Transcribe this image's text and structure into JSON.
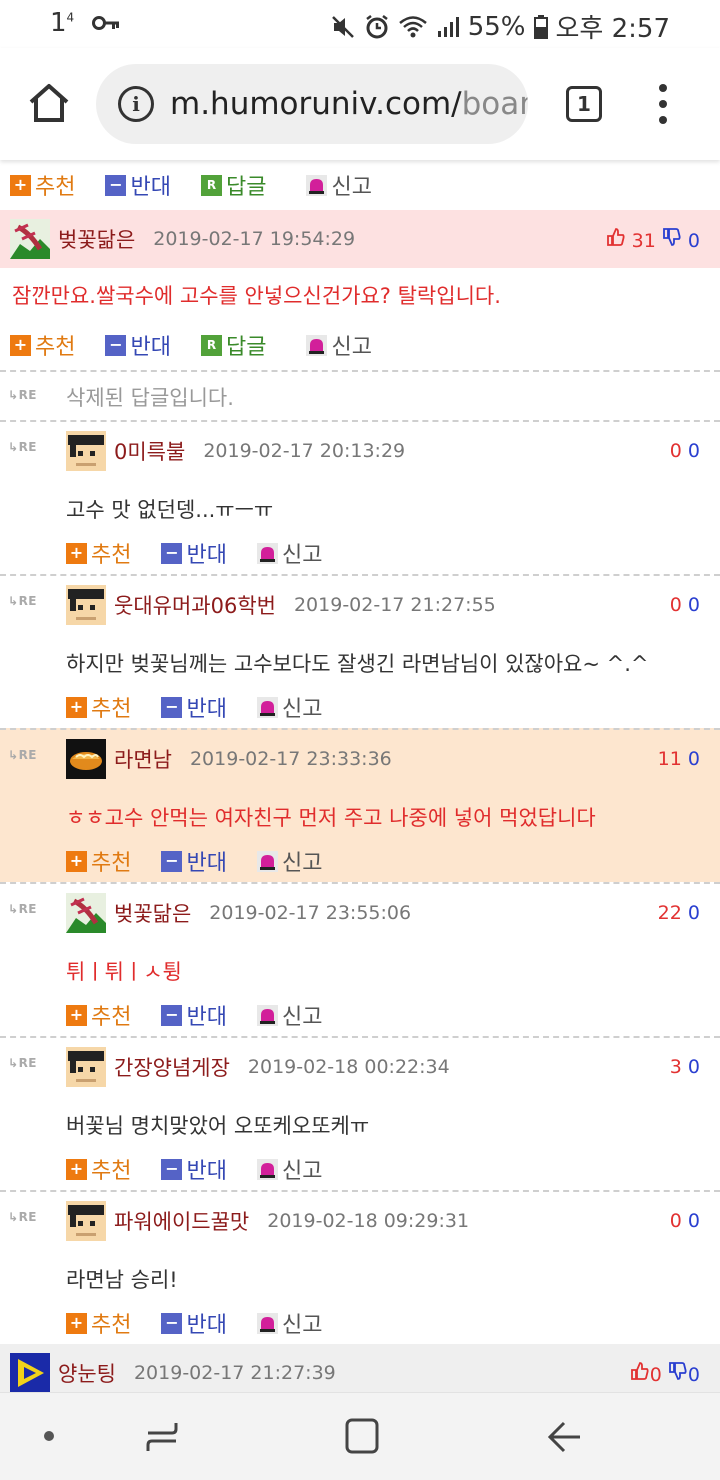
{
  "status_bar": {
    "notif_count": "1",
    "notif_sup": "4",
    "battery": "55%",
    "time": "오후 2:57"
  },
  "browser": {
    "url_main": "m.humoruniv.com/",
    "url_dim": "boar",
    "tab_count": "1"
  },
  "actions": {
    "up": "추천",
    "down": "반대",
    "reply": "답글",
    "report": "신고",
    "reply_icon": "R"
  },
  "deleted_text": "삭제된 답글입니다.",
  "re_label": "RE",
  "comments": {
    "c1": {
      "nick": "벚꽃닮은",
      "date": "2019-02-17 19:54:29",
      "up": "31",
      "down": "0",
      "text": "잠깐만요.쌀국수에 고수를 안넣으신건가요? 탈락입니다."
    },
    "r1": {
      "nick": "0미륵불",
      "date": "2019-02-17 20:13:29",
      "up": "0",
      "down": "0",
      "text": "고수 맛 없던뎅...ㅠㅡㅠ"
    },
    "r2": {
      "nick": "웃대유머과06학번",
      "date": "2019-02-17 21:27:55",
      "up": "0",
      "down": "0",
      "text": "하지만 벚꽃님께는 고수보다도 잘생긴 라면남님이 있잖아요~ ^.^"
    },
    "r3": {
      "nick": "라면남",
      "date": "2019-02-17 23:33:36",
      "up": "11",
      "down": "0",
      "text": "ㅎㅎ고수 안먹는 여자친구 먼저 주고 나중에 넣어 먹었답니다"
    },
    "r4": {
      "nick": "벚꽃닮은",
      "date": "2019-02-17 23:55:06",
      "up": "22",
      "down": "0",
      "text": "튀ㅣ튀ㅣㅅ튕"
    },
    "r5": {
      "nick": "간장양념게장",
      "date": "2019-02-18 00:22:34",
      "up": "3",
      "down": "0",
      "text": "버꽃님 명치맞았어 오또케오또케ㅠ"
    },
    "r6": {
      "nick": "파워에이드꿀맛",
      "date": "2019-02-18 09:29:31",
      "up": "0",
      "down": "0",
      "text": "라면남 승리!"
    },
    "c2": {
      "nick": "양눈팅",
      "date": "2019-02-17 21:27:39",
      "up": "0",
      "down": "0"
    }
  }
}
